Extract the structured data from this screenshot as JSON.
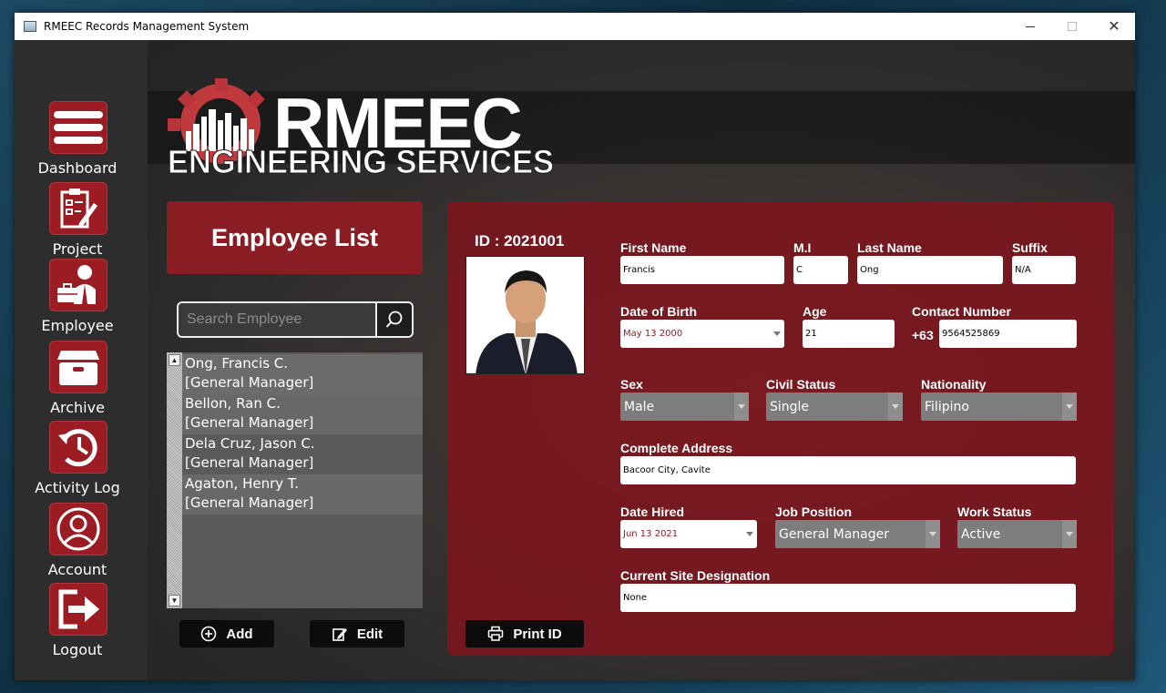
{
  "window": {
    "title": "RMEEC Records Management System"
  },
  "sidebar": {
    "items": [
      {
        "label": "Dashboard",
        "icon": "menu-icon"
      },
      {
        "label": "Project",
        "icon": "clipboard-icon"
      },
      {
        "label": "Employee",
        "icon": "employee-icon"
      },
      {
        "label": "Archive",
        "icon": "archive-box-icon"
      },
      {
        "label": "Activity Log",
        "icon": "history-icon"
      },
      {
        "label": "Account",
        "icon": "user-circle-icon"
      },
      {
        "label": "Logout",
        "icon": "logout-icon"
      }
    ]
  },
  "logo": {
    "line1": "RMEEC",
    "line2": "ENGINEERING SERVICES"
  },
  "employee_list": {
    "title": "Employee List",
    "search_placeholder": "Search Employee",
    "rows": [
      {
        "name": "Ong, Francis C.",
        "position": "[General Manager]"
      },
      {
        "name": "Bellon, Ran  C.",
        "position": "[General Manager]"
      },
      {
        "name": "Dela Cruz, Jason C.",
        "position": "[General Manager]"
      },
      {
        "name": "Agaton, Henry T.",
        "position": "[General Manager]"
      }
    ],
    "add_label": "Add",
    "edit_label": "Edit"
  },
  "details": {
    "id_text": "ID : 2021001",
    "print_label": "Print ID",
    "labels": {
      "first_name": "First Name",
      "mi": "M.I",
      "last_name": "Last Name",
      "suffix": "Suffix",
      "dob": "Date of Birth",
      "age": "Age",
      "contact": "Contact Number",
      "sex": "Sex",
      "civil_status": "Civil Status",
      "nationality": "Nationality",
      "address": "Complete Address",
      "date_hired": "Date Hired",
      "job_position": "Job Position",
      "work_status": "Work Status",
      "site": "Current Site Designation"
    },
    "values": {
      "first_name": "Francis",
      "mi": "C",
      "last_name": "Ong",
      "suffix": "N/A",
      "dob": "May 13  2000",
      "age": "21",
      "contact_prefix": "+63",
      "contact": "9564525869",
      "sex": "Male",
      "civil_status": "Single",
      "nationality": "Filipino",
      "address": "Bacoor City, Cavite",
      "date_hired": "Jun 13  2021",
      "job_position": "General Manager",
      "work_status": "Active",
      "site": "None"
    }
  },
  "colors": {
    "accent": "#9b1c22",
    "panel": "#7d141c",
    "dark_button": "#0c0c0c"
  }
}
